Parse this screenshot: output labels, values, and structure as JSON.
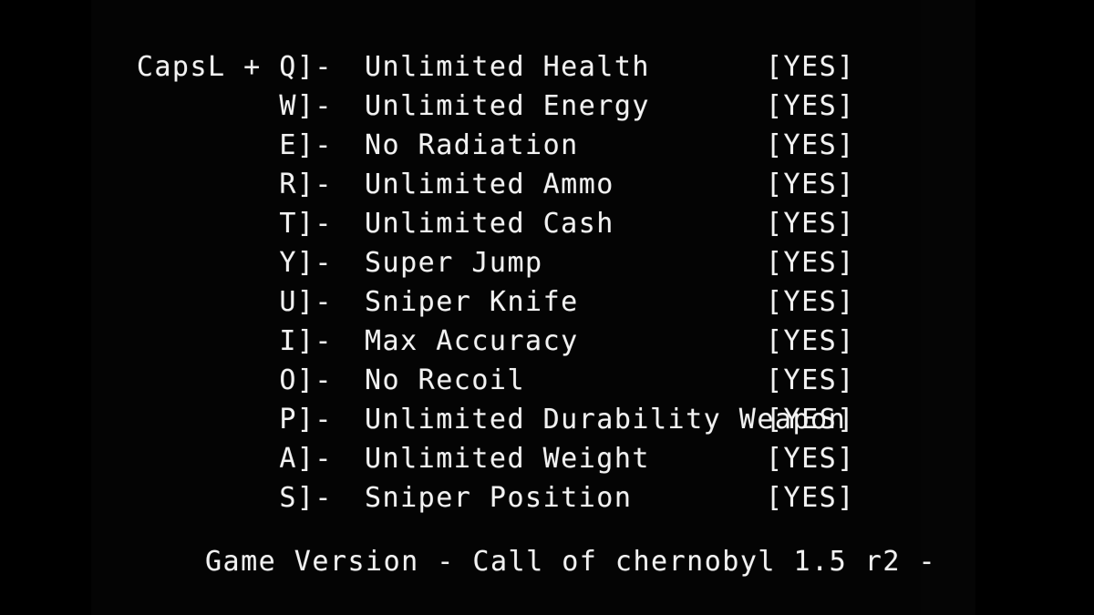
{
  "overlay": {
    "modifier_prefix": "CapsL + ",
    "key_suffix": "]-",
    "rows": [
      {
        "key": "Q",
        "key_display": "CapsL + Q]-",
        "label": "Unlimited Health",
        "status": "[YES]"
      },
      {
        "key": "W",
        "key_display": "W]-",
        "label": "Unlimited Energy",
        "status": "[YES]"
      },
      {
        "key": "E",
        "key_display": "E]-",
        "label": "No Radiation",
        "status": "[YES]"
      },
      {
        "key": "R",
        "key_display": "R]-",
        "label": "Unlimited Ammo",
        "status": "[YES]"
      },
      {
        "key": "T",
        "key_display": "T]-",
        "label": "Unlimited Cash",
        "status": "[YES]"
      },
      {
        "key": "Y",
        "key_display": "Y]-",
        "label": "Super Jump",
        "status": "[YES]"
      },
      {
        "key": "U",
        "key_display": "U]-",
        "label": "Sniper Knife",
        "status": "[YES]"
      },
      {
        "key": "I",
        "key_display": "I]-",
        "label": "Max Accuracy",
        "status": "[YES]"
      },
      {
        "key": "O",
        "key_display": "O]-",
        "label": "No Recoil",
        "status": "[YES]"
      },
      {
        "key": "P",
        "key_display": "P]-",
        "label": "Unlimited Durability Weapon",
        "status": "[YES]"
      },
      {
        "key": "A",
        "key_display": "A]-",
        "label": "Unlimited Weight",
        "status": "[YES]"
      },
      {
        "key": "S",
        "key_display": "S]-",
        "label": "Sniper Position",
        "status": "[YES]"
      }
    ],
    "footer": "Game Version - Call of chernobyl 1.5 r2 -",
    "colors": {
      "background": "#000000",
      "content_background": "#040404",
      "text": "#f2f2f2"
    }
  }
}
